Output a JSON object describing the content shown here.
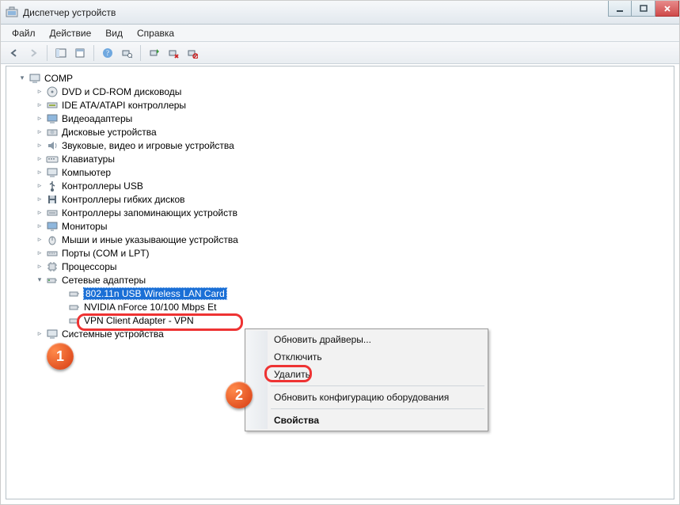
{
  "window": {
    "title": "Диспетчер устройств"
  },
  "menu": {
    "file": "Файл",
    "action": "Действие",
    "view": "Вид",
    "help": "Справка"
  },
  "tree": {
    "root": "COMP",
    "items": [
      "DVD и CD-ROM дисководы",
      "IDE ATA/ATAPI контроллеры",
      "Видеоадаптеры",
      "Дисковые устройства",
      "Звуковые, видео и игровые устройства",
      "Клавиатуры",
      "Компьютер",
      "Контроллеры USB",
      "Контроллеры гибких дисков",
      "Контроллеры запоминающих устройств",
      "Мониторы",
      "Мыши и иные указывающие устройства",
      "Порты (COM и LPT)",
      "Процессоры"
    ],
    "network_category": "Сетевые адаптеры",
    "network_items": [
      "802.11n USB Wireless LAN Card",
      "NVIDIA nForce 10/100 Mbps Et",
      "VPN Client Adapter - VPN"
    ],
    "system_devices": "Системные устройства"
  },
  "context_menu": {
    "update_drivers": "Обновить драйверы...",
    "disable": "Отключить",
    "delete": "Удалить",
    "rescan": "Обновить конфигурацию оборудования",
    "properties": "Свойства"
  },
  "annotations": {
    "badge1": "1",
    "badge2": "2"
  }
}
